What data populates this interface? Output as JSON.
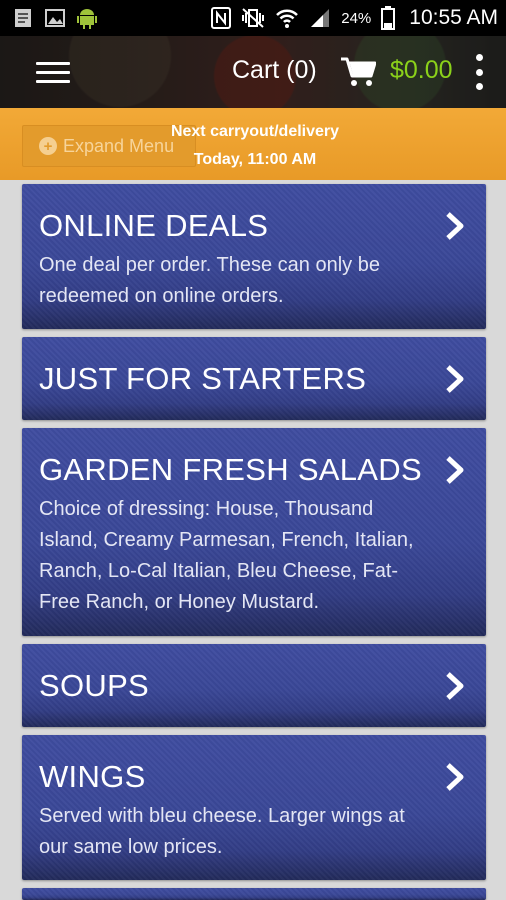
{
  "status_bar": {
    "battery": "24%",
    "time": "10:55 AM"
  },
  "header": {
    "cart_label": "Cart (0)",
    "cart_total": "$0.00",
    "total_color": "#8bd11a"
  },
  "notice": {
    "expand_label": "Expand Menu",
    "next_title": "Next carryout/delivery",
    "next_time": "Today, 11:00 AM"
  },
  "categories": [
    {
      "title": "ONLINE DEALS",
      "desc": "One deal per order. These can only be redeemed on online orders."
    },
    {
      "title": "JUST FOR STARTERS",
      "desc": ""
    },
    {
      "title": "GARDEN FRESH SALADS",
      "desc": "Choice of dressing: House, Thousand Island, Creamy Parmesan, French, Italian, Ranch, Lo-Cal Italian, Bleu Cheese, Fat-Free Ranch, or Honey Mustard."
    },
    {
      "title": "SOUPS",
      "desc": ""
    },
    {
      "title": "WINGS",
      "desc": "Served with bleu cheese. Larger wings at our same low prices."
    }
  ],
  "colors": {
    "accent_orange": "#f2a937",
    "category_blue": "#3a4797"
  }
}
